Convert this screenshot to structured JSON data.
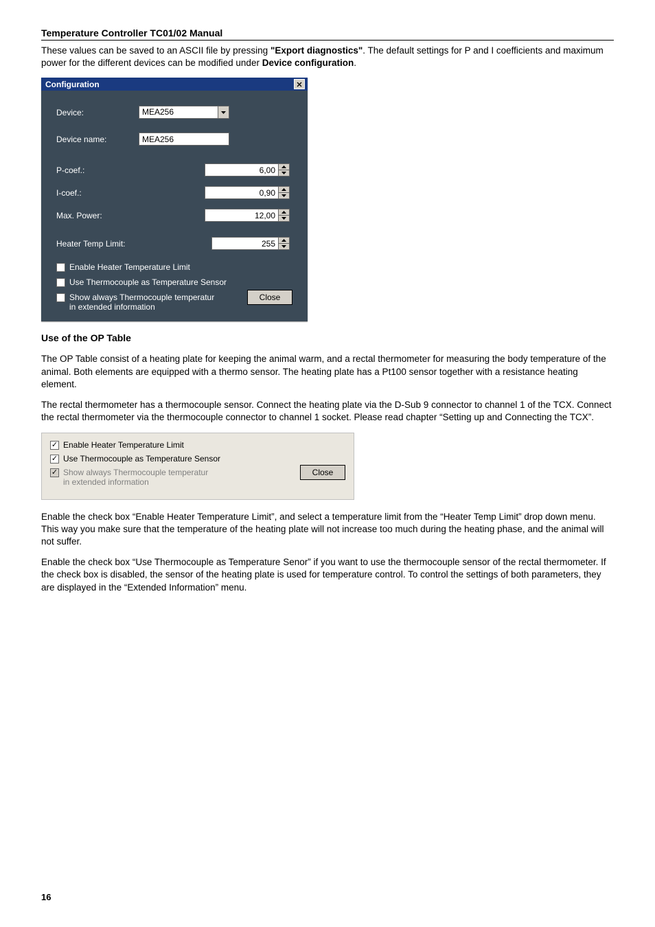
{
  "doc": {
    "title": "Temperature Controller TC01/02 Manual",
    "intro_1a": "These values can be saved to an ASCII file by pressing ",
    "intro_1b": "\"Export diagnostics\"",
    "intro_1c": ". The default settings for P and I coefficients and maximum power for the different devices can be modified under ",
    "intro_1d": "Device configuration",
    "intro_1e": ".",
    "page_number": "16"
  },
  "dialog": {
    "title": "Configuration",
    "device_label": "Device:",
    "device_value": "MEA256",
    "device_name_label": "Device name:",
    "device_name_value": "MEA256",
    "pcoef_label": "P-coef.:",
    "pcoef_value": "6,00",
    "icoef_label": "I-coef.:",
    "icoef_value": "0,90",
    "maxpower_label": "Max. Power:",
    "maxpower_value": "12,00",
    "heater_label": "Heater Temp Limit:",
    "heater_value": "255",
    "chk1": "Enable Heater Temperature Limit",
    "chk2": "Use Thermocouple as Temperature Sensor",
    "chk3a": "Show always Thermocouple temperatur",
    "chk3b": "in extended information",
    "close": "Close"
  },
  "section": {
    "head": "Use of the OP Table",
    "p1": "The OP Table consist of a heating plate for keeping the animal warm, and a rectal thermometer for measuring the body temperature of the animal. Both elements are equipped with a thermo sensor. The heating plate has a Pt100 sensor together with a resistance heating element.",
    "p2": "The rectal thermometer has a thermocouple sensor. Connect the heating plate via the D-Sub 9 connector to channel 1 of the TCX. Connect the rectal thermometer via the thermocouple connector to channel 1 socket. Please read chapter “Setting up and Connecting the TCX”."
  },
  "small_dialog": {
    "chk1": "Enable Heater Temperature Limit",
    "chk2": "Use Thermocouple as Temperature Sensor",
    "chk3a": "Show always Thermocouple temperatur",
    "chk3b": "in extended information",
    "close": "Close"
  },
  "after": {
    "p1": "Enable the check box “Enable Heater Temperature Limit”, and select a temperature limit from the “Heater Temp Limit” drop down menu. This way you make sure that the temperature of the heating plate will not increase too much during the heating phase, and the animal will not suffer.",
    "p2": "Enable the check box “Use Thermocouple as Temperature Senor” if you want to use the thermocouple sensor of the rectal thermometer. If the check box is disabled, the sensor of the heating plate is used for temperature control. To control the settings of both parameters, they are displayed in the “Extended Information” menu."
  }
}
